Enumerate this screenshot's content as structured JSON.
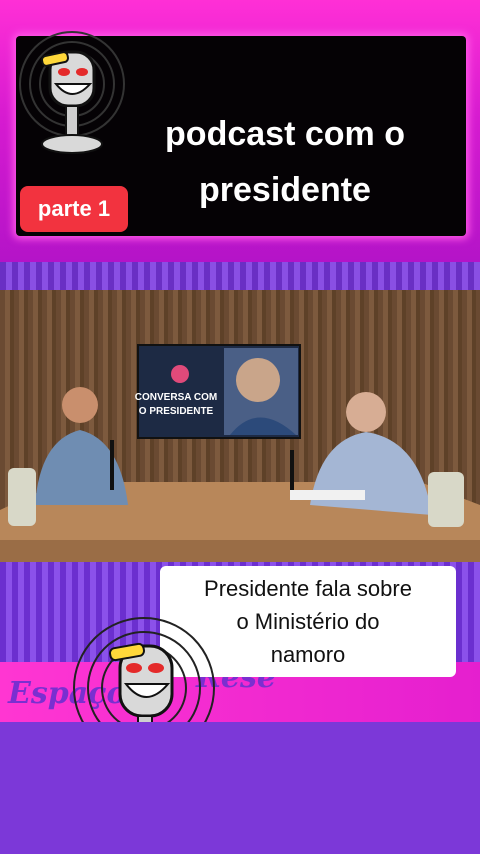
{
  "header": {
    "title_line1": "podcast com o",
    "title_line2": "presidente",
    "part_badge": "parte 1"
  },
  "video_frame": {
    "screen_text_line1": "CONVERSA COM",
    "screen_text_line2": "O PRESIDENTE"
  },
  "caption": {
    "line1": "Presidente fala sobre",
    "line2": "o Ministério do",
    "line3": "namoro"
  },
  "branding": {
    "word_left": "Espaço",
    "word_right": "Rese"
  },
  "colors": {
    "magenta": "#ff2fd6",
    "purple": "#7a35d6",
    "badge_red": "#f2333f"
  }
}
